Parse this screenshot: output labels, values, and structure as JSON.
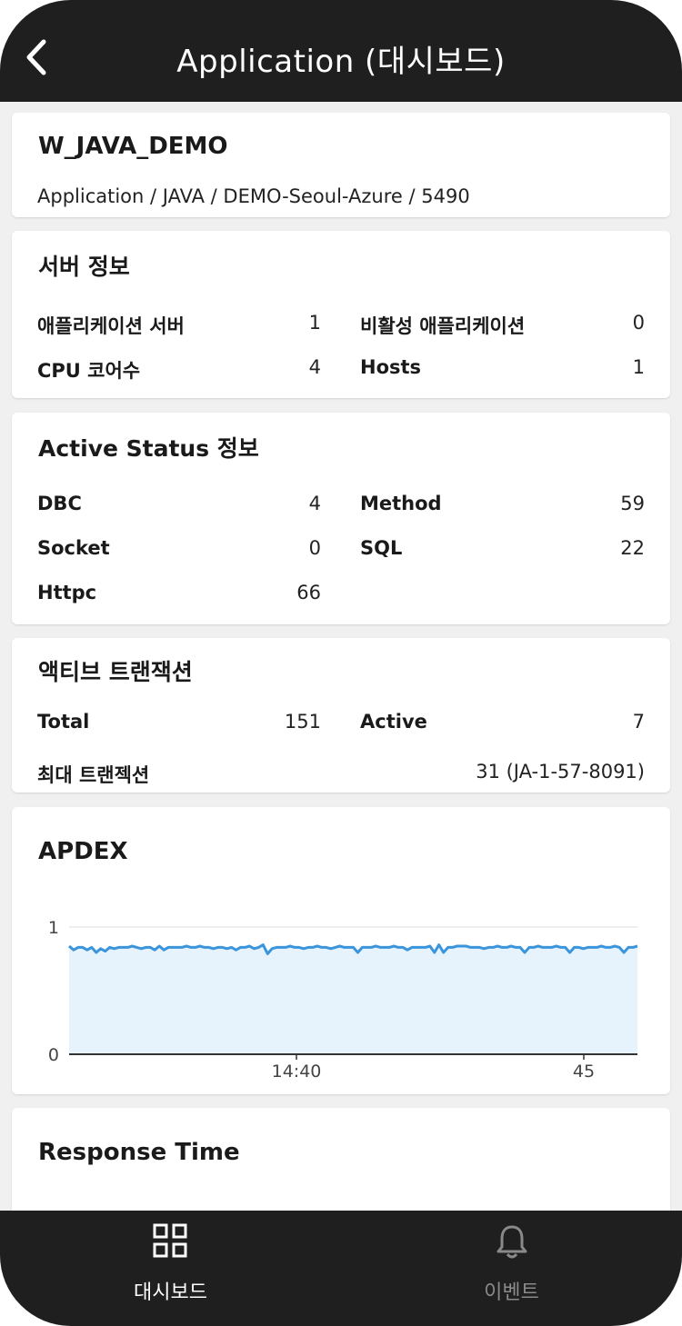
{
  "header": {
    "title": "Application (대시보드)"
  },
  "app_info": {
    "name": "W_JAVA_DEMO",
    "path": "Application / JAVA / DEMO-Seoul-Azure / 5490"
  },
  "server_info": {
    "title": "서버 정보",
    "items": [
      {
        "label": "애플리케이션 서버",
        "value": "1"
      },
      {
        "label": "비활성 애플리케이션",
        "value": "0"
      },
      {
        "label": "CPU 코어수",
        "value": "4"
      },
      {
        "label": "Hosts",
        "value": "1"
      }
    ]
  },
  "active_status": {
    "title": "Active Status 정보",
    "items": [
      {
        "label": "DBC",
        "value": "4"
      },
      {
        "label": "Method",
        "value": "59"
      },
      {
        "label": "Socket",
        "value": "0"
      },
      {
        "label": "SQL",
        "value": "22"
      },
      {
        "label": "Httpc",
        "value": "66"
      }
    ]
  },
  "active_transactions": {
    "title": "액티브 트랜잭션",
    "total_label": "Total",
    "total_value": "151",
    "active_label": "Active",
    "active_value": "7",
    "max_label": "최대 트랜젝션",
    "max_value": "31 (JA-1-57-8091)"
  },
  "apdex": {
    "title": "APDEX"
  },
  "response_time": {
    "title": "Response Time"
  },
  "bottom_nav": {
    "dashboard_label": "대시보드",
    "events_label": "이벤트"
  },
  "colors": {
    "line": "#3a95dc",
    "fill": "#e6f2fc",
    "dark_bar": "#1f1f1f"
  },
  "chart_data": {
    "type": "area",
    "title": "APDEX",
    "xlabel": "",
    "ylabel": "",
    "ylim": [
      0,
      1
    ],
    "y_ticks": [
      "0",
      "1"
    ],
    "x_ticks": [
      "14:40",
      "45"
    ],
    "series": [
      {
        "values": [
          0.85,
          0.82,
          0.84,
          0.84,
          0.82,
          0.84,
          0.8,
          0.83,
          0.81,
          0.84,
          0.83,
          0.84,
          0.84,
          0.84,
          0.85,
          0.84,
          0.83,
          0.84,
          0.84,
          0.82,
          0.85,
          0.82,
          0.84,
          0.84,
          0.84,
          0.84,
          0.85,
          0.84,
          0.84,
          0.85,
          0.84,
          0.84,
          0.83,
          0.84,
          0.84,
          0.83,
          0.84,
          0.82,
          0.84,
          0.84,
          0.85,
          0.83,
          0.84,
          0.86,
          0.79,
          0.83,
          0.84,
          0.84,
          0.84,
          0.85,
          0.84,
          0.84,
          0.83,
          0.84,
          0.84,
          0.85,
          0.84,
          0.84,
          0.83,
          0.84,
          0.85,
          0.84,
          0.84,
          0.84,
          0.8,
          0.84,
          0.84,
          0.84,
          0.85,
          0.84,
          0.84,
          0.84,
          0.85,
          0.84,
          0.84,
          0.82,
          0.84,
          0.84,
          0.84,
          0.84,
          0.85,
          0.8,
          0.86,
          0.8,
          0.84,
          0.84,
          0.85,
          0.85,
          0.85,
          0.84,
          0.84,
          0.84,
          0.83,
          0.84,
          0.84,
          0.85,
          0.84,
          0.84,
          0.85,
          0.84,
          0.84,
          0.8,
          0.84,
          0.84,
          0.85,
          0.84,
          0.84,
          0.84,
          0.85,
          0.84,
          0.84,
          0.8,
          0.84,
          0.84,
          0.83,
          0.84,
          0.84,
          0.84,
          0.85,
          0.84,
          0.84,
          0.85,
          0.84,
          0.8,
          0.84,
          0.84,
          0.85
        ]
      }
    ]
  }
}
